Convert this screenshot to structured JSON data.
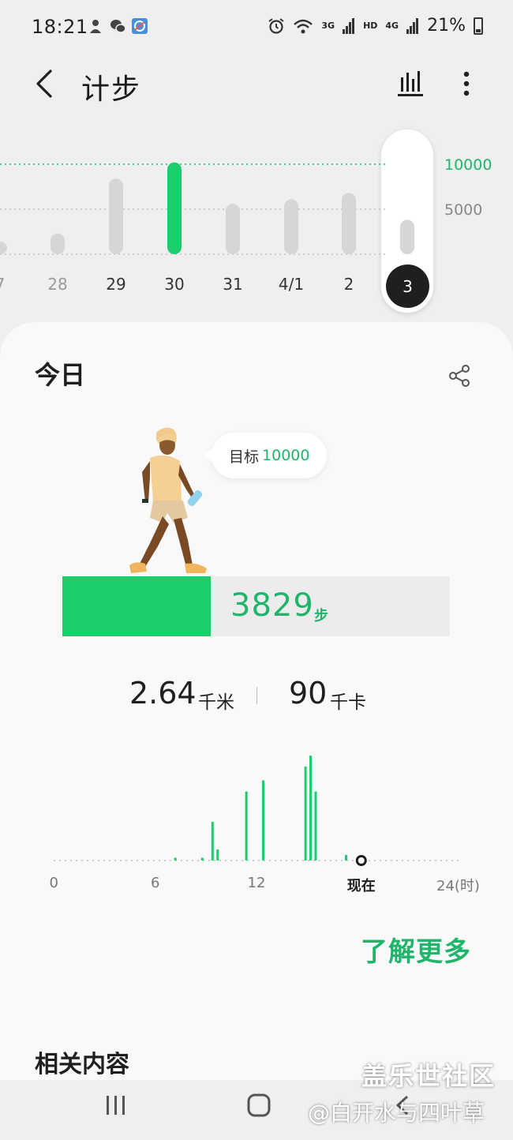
{
  "status_bar": {
    "time": "18:21",
    "network_3g": "3G",
    "network_hd": "HD",
    "network_4g": "4G",
    "battery": "21%"
  },
  "header": {
    "title": "计步"
  },
  "weekly_chart": {
    "goal_label": "10000",
    "mid_label": "5000",
    "days": [
      "7",
      "28",
      "29",
      "30",
      "31",
      "4/1",
      "2"
    ],
    "selected_day": "3",
    "values": [
      800,
      2300,
      8400,
      10200,
      5600,
      6100,
      6800,
      3829
    ],
    "goal": 10000,
    "colors": {
      "goal": "#1fb56b",
      "bar": "#d6d6d6",
      "met": "#1ccd6b"
    }
  },
  "today": {
    "title": "今日",
    "goal_label": "目标",
    "goal_value": "10000",
    "steps": "3829",
    "steps_unit": "步",
    "steps_fraction": 0.3829,
    "distance": "2.64",
    "distance_unit": "千米",
    "calories": "90",
    "calories_unit": "千卡"
  },
  "chart_data": {
    "type": "bar",
    "x": [
      7.2,
      8.8,
      9.4,
      9.7,
      11.4,
      12.4,
      14.9,
      15.2,
      15.5,
      17.3
    ],
    "values": [
      1,
      1,
      14,
      4,
      25,
      29,
      34,
      38,
      25,
      2
    ],
    "xticks": [
      "0",
      "6",
      "12",
      "现在",
      "24(时)"
    ],
    "xtick_values": [
      0,
      6,
      12,
      18,
      24
    ],
    "xlim": [
      0,
      24
    ],
    "now_hour": 18.2,
    "color": "#1ccd6b"
  },
  "actions": {
    "learn_more": "了解更多"
  },
  "related": {
    "title": "相关内容"
  },
  "watermark": {
    "line1": "盖乐世社区",
    "line2": "@白开水与四叶草"
  }
}
